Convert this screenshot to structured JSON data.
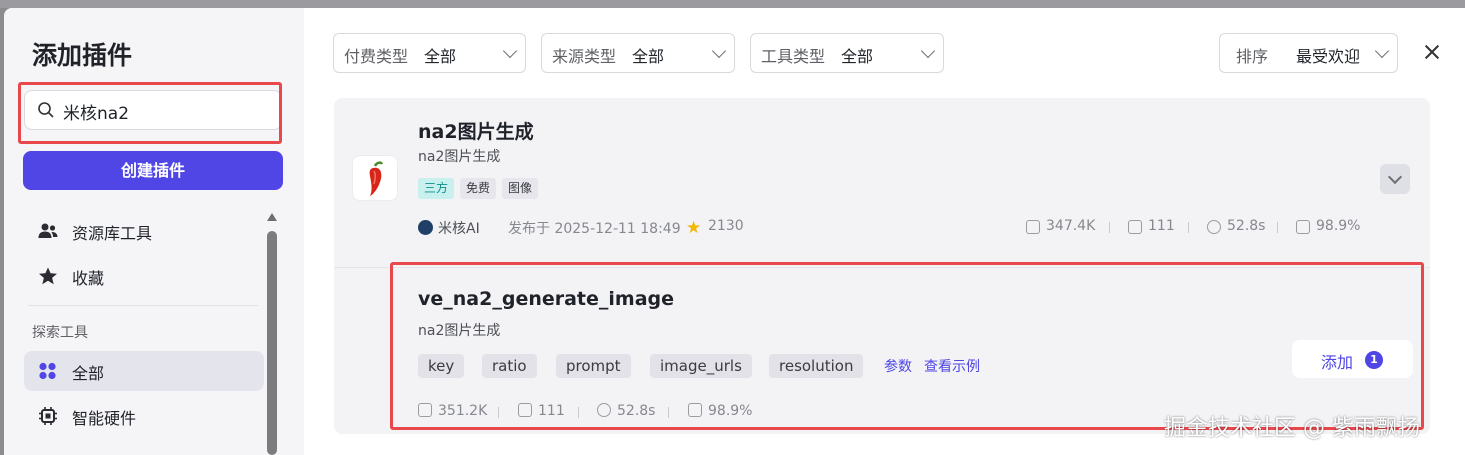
{
  "sidebar": {
    "title": "添加插件",
    "search_value": "米核na2",
    "create_label": "创建插件",
    "items_top": [
      {
        "label": "资源库工具"
      },
      {
        "label": "收藏"
      }
    ],
    "section_label": "探索工具",
    "items_explore": [
      {
        "label": "全部",
        "active": true
      },
      {
        "label": "智能硬件"
      }
    ]
  },
  "filters": [
    {
      "key": "付费类型",
      "value": "全部"
    },
    {
      "key": "来源类型",
      "value": "全部"
    },
    {
      "key": "工具类型",
      "value": "全部"
    }
  ],
  "sort": {
    "key": "排序",
    "value": "最受欢迎"
  },
  "plugin": {
    "name": "na2图片生成",
    "desc": "na2图片生成",
    "tags": [
      "三方",
      "免费",
      "图像"
    ],
    "author": "米核AI",
    "published": "发布于 2025-12-11 18:49",
    "stars": "2130",
    "stats": {
      "usage": "347.4K",
      "bots": "111",
      "latency": "52.8s",
      "success": "98.9%"
    }
  },
  "tool": {
    "name": "ve_na2_generate_image",
    "desc": "na2图片生成",
    "params": [
      "key",
      "ratio",
      "prompt",
      "image_urls",
      "resolution"
    ],
    "params_link": "参数",
    "example_link": "查看示例",
    "add_label": "添加",
    "add_count": "1",
    "stats": {
      "usage": "351.2K",
      "bots": "111",
      "latency": "52.8s",
      "success": "98.9%"
    }
  },
  "watermark": "掘金技术社区 @ 紫雨飘扬",
  "colors": {
    "accent": "#4f46e5",
    "highlight": "#e8474c",
    "third_party_tag": "#0e8f8a"
  }
}
